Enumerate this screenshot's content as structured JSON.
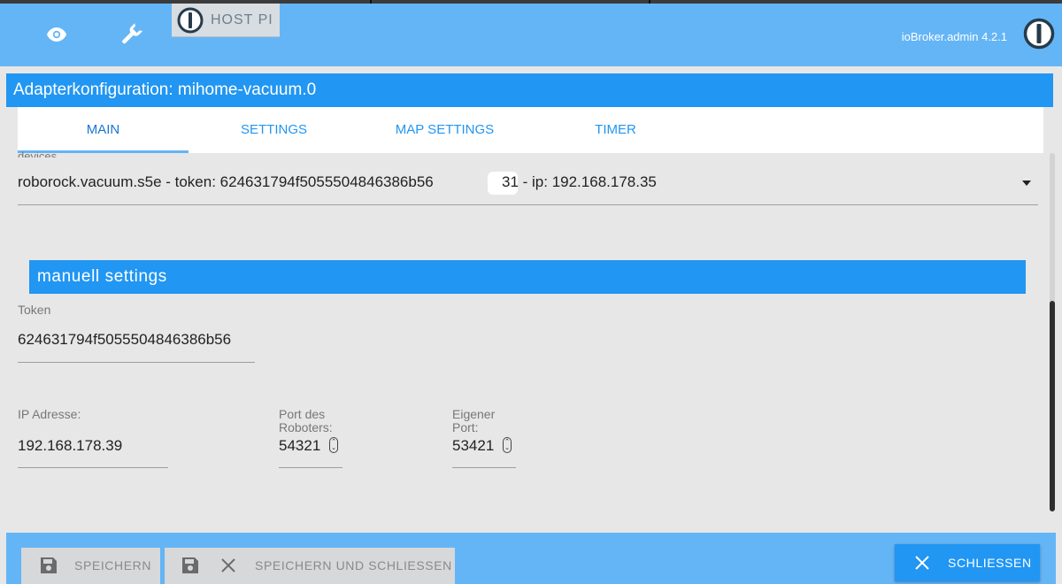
{
  "header": {
    "host_label": "HOST PI",
    "version": "ioBroker.admin 4.2.1",
    "icons": [
      "eye-icon",
      "wrench-icon",
      "iobroker-logo-icon"
    ]
  },
  "page": {
    "title": "Adapterkonfiguration: mihome-vacuum.0"
  },
  "tabs": [
    {
      "label": "MAIN",
      "active": true
    },
    {
      "label": "SETTINGS",
      "active": false
    },
    {
      "label": "MAP SETTINGS",
      "active": false
    },
    {
      "label": "TIMER",
      "active": false
    }
  ],
  "main": {
    "devices_label": "devices",
    "device_select": {
      "value_start": "roborock.vacuum.s5e - token: 624631794f5055504846386b56",
      "value_end": "31 - ip: 192.168.178.35"
    },
    "section_title": "manuell settings",
    "token": {
      "label": "Token",
      "value": "624631794f5055504846386b56"
    },
    "ip": {
      "label": "IP Adresse:",
      "value": "192.168.178.39"
    },
    "robot_port": {
      "label_line1": "Port des",
      "label_line2": "Roboters:",
      "value": "54321"
    },
    "own_port": {
      "label_line1": "Eigener",
      "label_line2": "Port:",
      "value": "53421"
    }
  },
  "footer": {
    "save_label": "SPEICHERN",
    "save_close_label": "SPEICHERN UND SCHLIESSEN",
    "close_label": "SCHLIESSEN"
  },
  "colors": {
    "header_bg": "#64b5f6",
    "accent": "#2196f3",
    "background": "#e7e7e7"
  }
}
